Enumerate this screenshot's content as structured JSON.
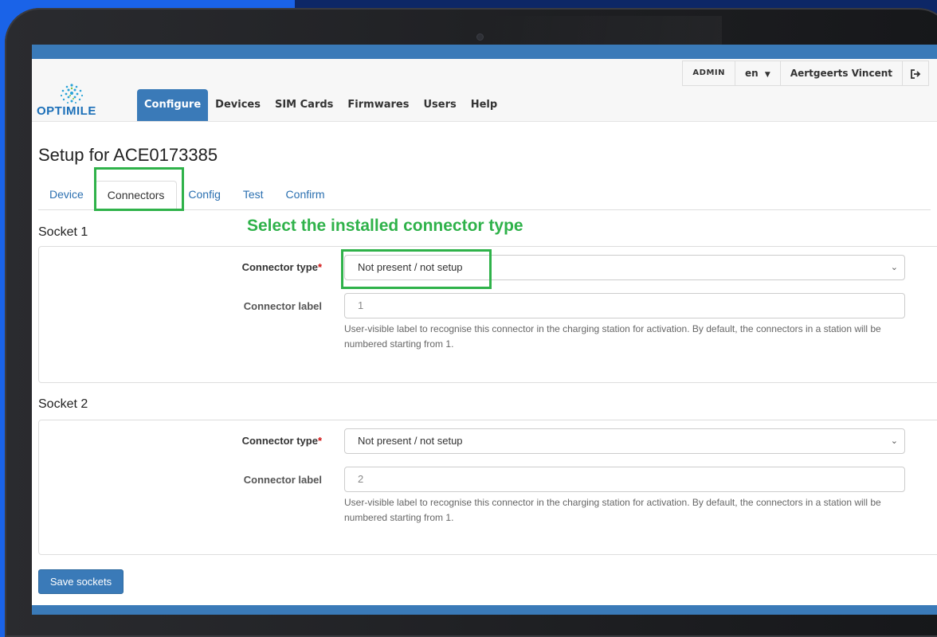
{
  "app": {
    "logo_text": "OPTIMILE",
    "brand_color": "#3a7ab8",
    "highlight_color": "#2fb24a"
  },
  "header": {
    "menu": [
      {
        "label": "Configure",
        "active": true
      },
      {
        "label": "Devices"
      },
      {
        "label": "SIM Cards"
      },
      {
        "label": "Firmwares"
      },
      {
        "label": "Users"
      },
      {
        "label": "Help"
      }
    ],
    "role_badge": "ADMIN",
    "language": "en",
    "user_name": "Aertgeerts Vincent",
    "logout_icon": "logout-icon"
  },
  "page": {
    "title": "Setup for ACE0173385",
    "tabs": [
      {
        "label": "Device"
      },
      {
        "label": "Connectors",
        "active": true
      },
      {
        "label": "Config"
      },
      {
        "label": "Test"
      },
      {
        "label": "Confirm"
      }
    ],
    "callout": "Select the installed connector type"
  },
  "sockets": [
    {
      "title": "Socket 1",
      "connector_type_label": "Connector type",
      "required_mark": "*",
      "connector_type_value": "Not present / not setup",
      "connector_label_label": "Connector label",
      "connector_label_placeholder": "1",
      "help": "User-visible label to recognise this connector in the charging station for activation. By default, the connectors in a station will be numbered starting from 1."
    },
    {
      "title": "Socket 2",
      "connector_type_label": "Connector type",
      "required_mark": "*",
      "connector_type_value": "Not present / not setup",
      "connector_label_label": "Connector label",
      "connector_label_placeholder": "2",
      "help": "User-visible label to recognise this connector in the charging station for activation. By default, the connectors in a station will be numbered starting from 1."
    }
  ],
  "actions": {
    "save_label": "Save sockets"
  }
}
